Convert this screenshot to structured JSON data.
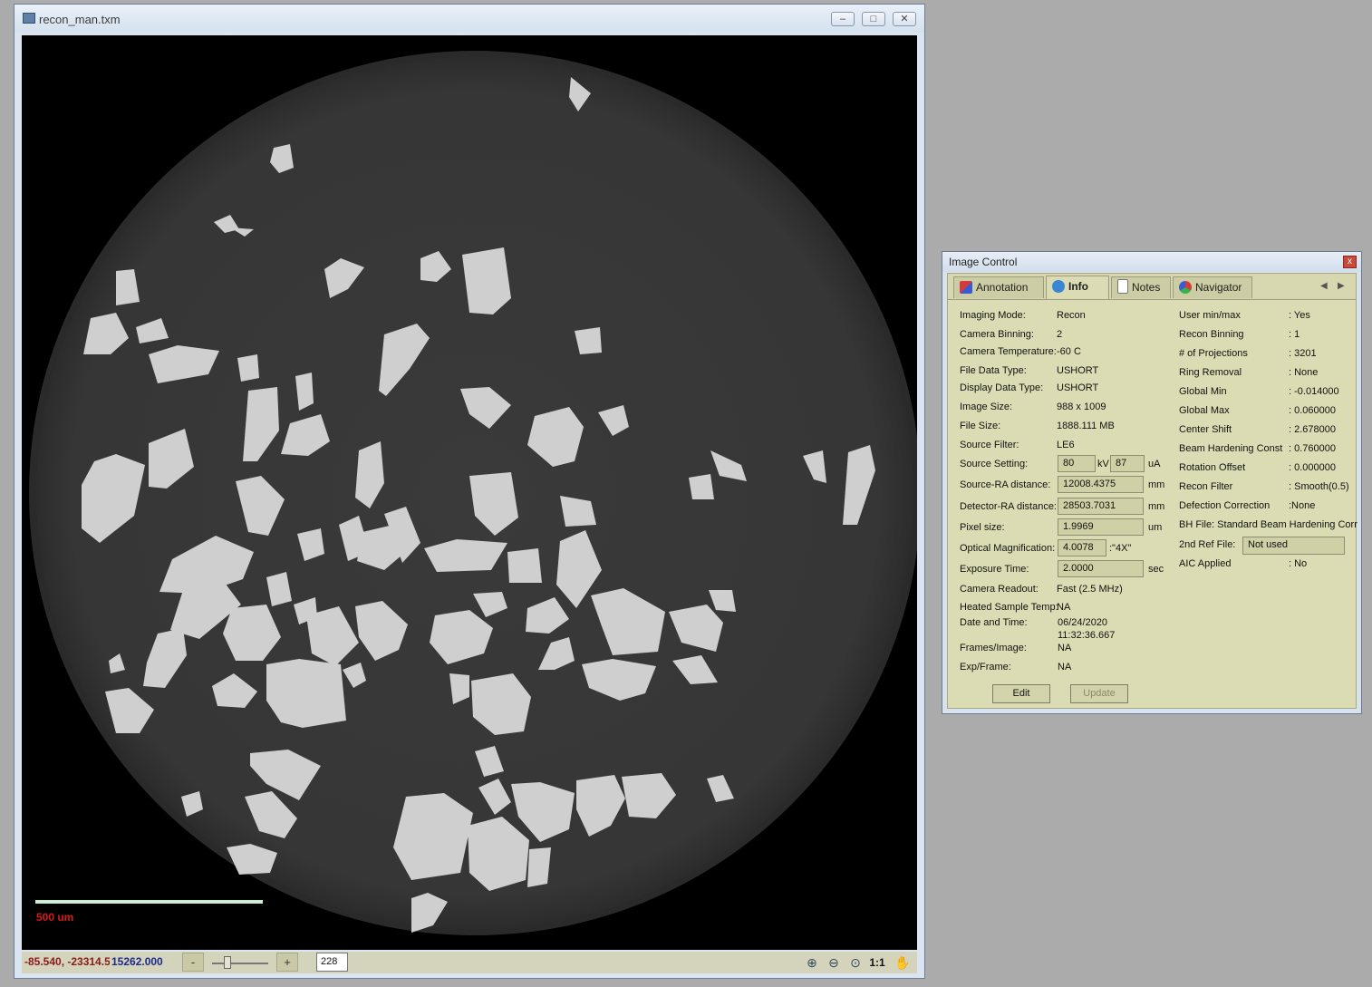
{
  "image_window": {
    "title": "recon_man.txm",
    "scale_bar_label": "500 um",
    "status": {
      "coordinates": "-85.540, -23314.5",
      "value": "15262.000",
      "zoom_out_label": "-",
      "zoom_in_label": "+",
      "slice_value": "228",
      "slice_fraction": 0.24,
      "fit_label": "1:1"
    },
    "icons": [
      "zoom-in-icon",
      "zoom-out-icon",
      "zoom-fit-icon",
      "hand-pan-icon"
    ]
  },
  "image_control": {
    "title": "Image Control",
    "close_label": "x",
    "tabs": [
      {
        "label": "Annotation"
      },
      {
        "label": "Info"
      },
      {
        "label": "Notes"
      },
      {
        "label": "Navigator"
      }
    ],
    "left": {
      "imaging_mode": {
        "label": "Imaging Mode:",
        "value": "Recon"
      },
      "camera_binning": {
        "label": "Camera Binning:",
        "value": "2"
      },
      "camera_temperature": {
        "label": "Camera Temperature:",
        "value": "-60 C"
      },
      "file_data_type": {
        "label": "File Data Type:",
        "value": "USHORT"
      },
      "display_data_type": {
        "label": "Display Data Type:",
        "value": "USHORT"
      },
      "image_size": {
        "label": "Image Size:",
        "value": "988 x 1009"
      },
      "file_size": {
        "label": "File Size:",
        "value": "1888.111 MB"
      },
      "source_filter": {
        "label": "Source Filter:",
        "value": "LE6"
      },
      "source_setting": {
        "label": "Source Setting:",
        "kv": "80",
        "kv_unit": "kV",
        "ua": "87",
        "ua_unit": "uA"
      },
      "source_ra_distance": {
        "label": "Source-RA distance:",
        "value": "12008.4375",
        "unit": "mm"
      },
      "detector_ra_distance": {
        "label": "Detector-RA distance:",
        "value": "28503.7031",
        "unit": "mm"
      },
      "pixel_size": {
        "label": "Pixel size:",
        "value": "1.9969",
        "unit": "um"
      },
      "optical_magnification": {
        "label": "Optical Magnification:",
        "value": "4.0078",
        "unit": ":\"4X\""
      },
      "exposure_time": {
        "label": "Exposure Time:",
        "value": "2.0000",
        "unit": "sec"
      },
      "camera_readout": {
        "label": "Camera Readout:",
        "value": "Fast (2.5 MHz)"
      },
      "heated_sample_temp": {
        "label": "Heated Sample Temp:",
        "value": "NA"
      },
      "date_and_time": {
        "label": "Date and Time:",
        "date": "06/24/2020",
        "time": "11:32:36.667"
      },
      "frames_image": {
        "label": "Frames/Image:",
        "value": "NA"
      },
      "exp_frame": {
        "label": "Exp/Frame:",
        "value": "NA"
      }
    },
    "right": {
      "user_min_max": {
        "label": "User min/max",
        "value": ": Yes"
      },
      "recon_binning": {
        "label": "Recon Binning",
        "value": ": 1"
      },
      "num_projections": {
        "label": "# of Projections",
        "value": ": 3201"
      },
      "ring_removal": {
        "label": "Ring Removal",
        "value": ": None"
      },
      "global_min": {
        "label": "Global Min",
        "value": ": -0.014000"
      },
      "global_max": {
        "label": "Global Max",
        "value": ": 0.060000"
      },
      "center_shift": {
        "label": "Center Shift",
        "value": ": 2.678000"
      },
      "beam_hardening_const": {
        "label": "Beam Hardening Const",
        "value": ": 0.760000"
      },
      "rotation_offset": {
        "label": "Rotation Offset",
        "value": ": 0.000000"
      },
      "recon_filter": {
        "label": "Recon Filter",
        "value": ": Smooth(0.5)"
      },
      "defection_correction": {
        "label": "Defection Correction",
        "value": ":None"
      },
      "bh_file": {
        "label": "BH File: Standard Beam Hardening Corr"
      },
      "second_ref_file": {
        "label": "2nd Ref File:",
        "value": "Not used"
      },
      "aic_applied": {
        "label": "AIC Applied",
        "value": ": No"
      }
    },
    "buttons": {
      "edit": "Edit",
      "update": "Update"
    }
  },
  "colors": {
    "desktop": "#ababab",
    "scale_bar": "#cbefd0",
    "scale_label": "#d71919",
    "panel_bg": "#dcdcb4",
    "coord_text": "#8b1a1a",
    "value_text": "#1c2a8a"
  }
}
